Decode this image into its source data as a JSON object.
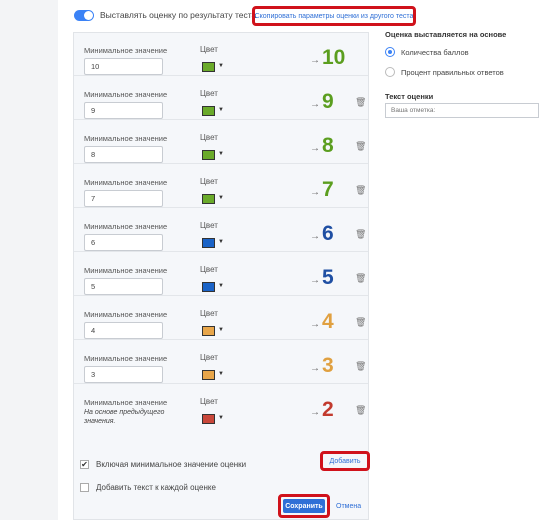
{
  "header": {
    "toggle_label": "Выставлять оценку по результату теста",
    "copy_link": "Скопировать параметры оценки из другого теста"
  },
  "grades": [
    {
      "min_label": "Минимальное значение",
      "value": "10",
      "color_label": "Цвет",
      "color": "#6aaa2a",
      "grade": "10",
      "grade_color": "#5b9e1f"
    },
    {
      "min_label": "Минимальное значение",
      "value": "9",
      "color_label": "Цвет",
      "color": "#6aaa2a",
      "grade": "9",
      "grade_color": "#5b9e1f"
    },
    {
      "min_label": "Минимальное значение",
      "value": "8",
      "color_label": "Цвет",
      "color": "#6aaa2a",
      "grade": "8",
      "grade_color": "#5b9e1f"
    },
    {
      "min_label": "Минимальное значение",
      "value": "7",
      "color_label": "Цвет",
      "color": "#6aaa2a",
      "grade": "7",
      "grade_color": "#5b9e1f"
    },
    {
      "min_label": "Минимальное значение",
      "value": "6",
      "color_label": "Цвет",
      "color": "#1a63c7",
      "grade": "6",
      "grade_color": "#1f4fa3"
    },
    {
      "min_label": "Минимальное значение",
      "value": "5",
      "color_label": "Цвет",
      "color": "#1a63c7",
      "grade": "5",
      "grade_color": "#1f4fa3"
    },
    {
      "min_label": "Минимальное значение",
      "value": "4",
      "color_label": "Цвет",
      "color": "#e8a64a",
      "grade": "4",
      "grade_color": "#e0a040"
    },
    {
      "min_label": "Минимальное значение",
      "value": "3",
      "color_label": "Цвет",
      "color": "#e8a64a",
      "grade": "3",
      "grade_color": "#e0a040"
    },
    {
      "min_label": "Минимальное значение",
      "note": "На основе предыдущего значения.",
      "color_label": "Цвет",
      "color": "#c9473a",
      "grade": "2",
      "grade_color": "#c23a2e"
    }
  ],
  "options": {
    "include_min": "Включая минимальное значение оценки",
    "add_text": "Добавить текст к каждой оценке"
  },
  "actions": {
    "add": "Добавить",
    "save": "Сохранить",
    "cancel": "Отмена"
  },
  "right": {
    "basis_heading": "Оценка выставляется на основе",
    "basis_options": [
      "Количества баллов",
      "Процент правильных ответов"
    ],
    "text_heading": "Текст оценки",
    "text_placeholder": "Ваша отметка:"
  },
  "icons": {
    "arrow": "→",
    "trash": "🗑",
    "caret": "▼",
    "check": "✔"
  }
}
